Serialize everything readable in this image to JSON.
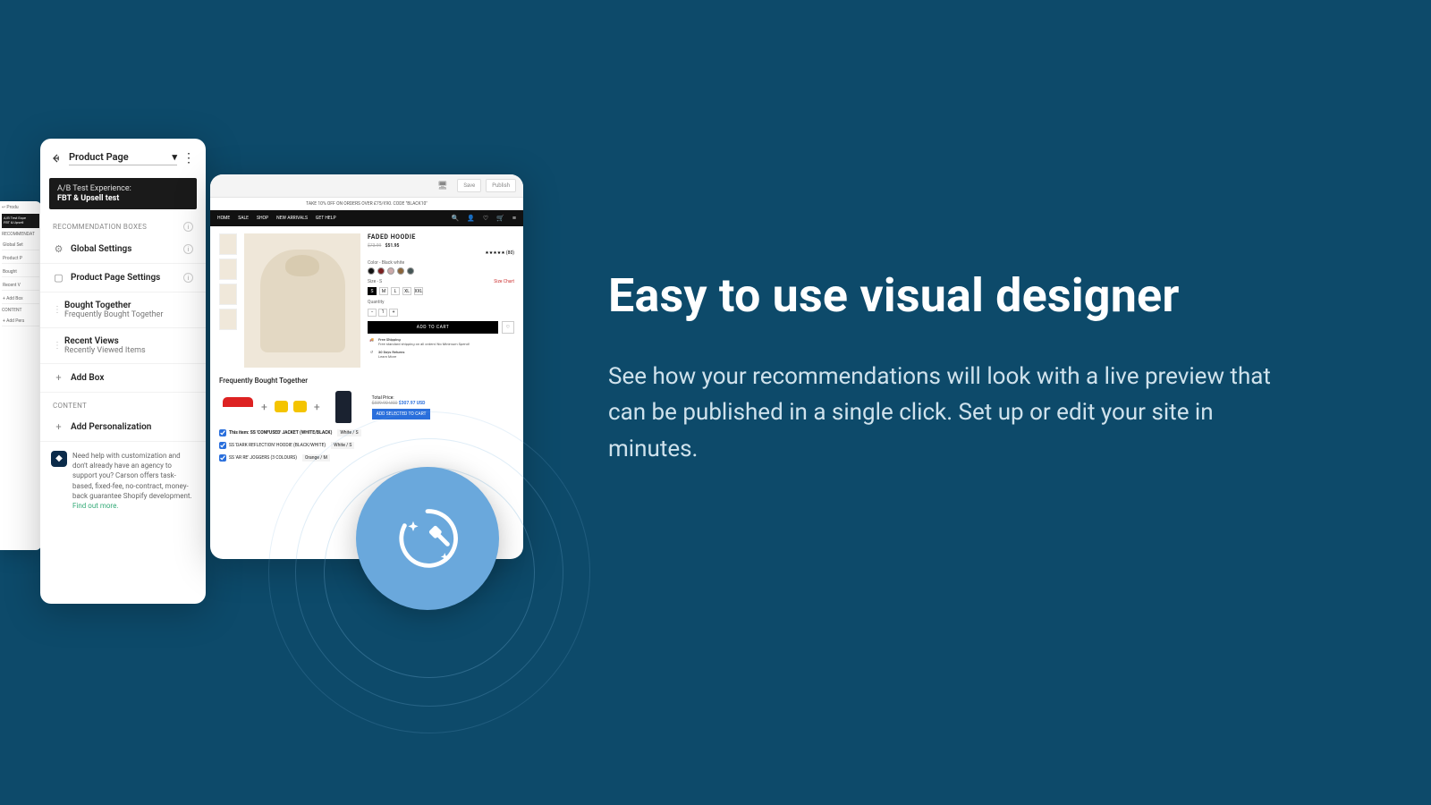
{
  "marketing": {
    "headline": "Easy to use visual designer",
    "body": "See how your recommendations will look with a live preview that can be published in a single click. Set up or edit your site in minutes."
  },
  "editor": {
    "page_select": "Product Page",
    "ab": {
      "sub": "A/B Test Experience:",
      "name": "FBT & Upsell test"
    },
    "rec_heading": "RECOMMENDATION BOXES",
    "global_settings": "Global Settings",
    "page_settings": "Product Page Settings",
    "boxes": [
      {
        "title": "Bought Together",
        "sub": "Frequently Bought Together"
      },
      {
        "title": "Recent Views",
        "sub": "Recently Viewed Items"
      }
    ],
    "add_box": "Add Box",
    "content_heading": "CONTENT",
    "add_personalization": "Add Personalization",
    "help": {
      "text": "Need help with customization and don't already have an agency to support you? Carson offers task-based, fixed-fee, no-contract, money-back guarantee Shopify development.",
      "link": "Find out more."
    }
  },
  "preview": {
    "toolbar": {
      "save": "Save",
      "publish": "Publish"
    },
    "promo_banner": "TAKE 10% OFF ON ORDERS OVER £75/€90. CODE \"BLACK10\"",
    "nav": [
      "HOME",
      "SALE",
      "SHOP",
      "NEW ARRIVALS",
      "GET HELP"
    ],
    "product": {
      "title": "FADED HOODIE",
      "old_price": "$73.99",
      "price": "$51.95",
      "rating_tag": "(80)",
      "color_label": "Color - Black white",
      "swatches": [
        "#111",
        "#7a1f1f",
        "#caa",
        "#8a643a",
        "#455"
      ],
      "size_label": "Size - S",
      "sizes": [
        "S",
        "M",
        "L",
        "XL",
        "XXL"
      ],
      "size_chart": "Size Chart",
      "qty_label": "Quantity",
      "qty": "1",
      "add_to_cart": "ADD TO CART",
      "perks": [
        {
          "icon": "🚚",
          "t": "Free Shipping",
          "s": "Free standard shipping on all orders! No Minimum Spend!"
        },
        {
          "icon": "↺",
          "t": "30 Days Returns",
          "s": "Learn More"
        }
      ]
    },
    "fbt": {
      "heading": "Frequently Bought Together",
      "total_label": "Total Price:",
      "old_total": "$339.90 USD",
      "new_total": "$307.97 USD",
      "add_selected": "ADD SELECTED TO CART",
      "items": [
        {
          "label": "This item: SS 'CONFUSED' JACKET (WHITE/BLACK)",
          "variant": "White / S"
        },
        {
          "label": "SS 'DARK REFLECTION' HOODIE (BLACK/WHITE)",
          "variant": "White / S"
        },
        {
          "label": "SS 'AR RE' JOGGERS (3 COLOURS)",
          "variant": "Orange / M"
        }
      ]
    }
  },
  "back_panel": {
    "ab_sub": "A/B Test Expe",
    "ab_name": "FBT & Upsell",
    "heading": "RECOMMENDAT",
    "rows": [
      "Global Set",
      "Product P",
      "Bought",
      "Recent V",
      "Add Box"
    ],
    "content": "CONTENT",
    "addp": "Add Pers"
  }
}
